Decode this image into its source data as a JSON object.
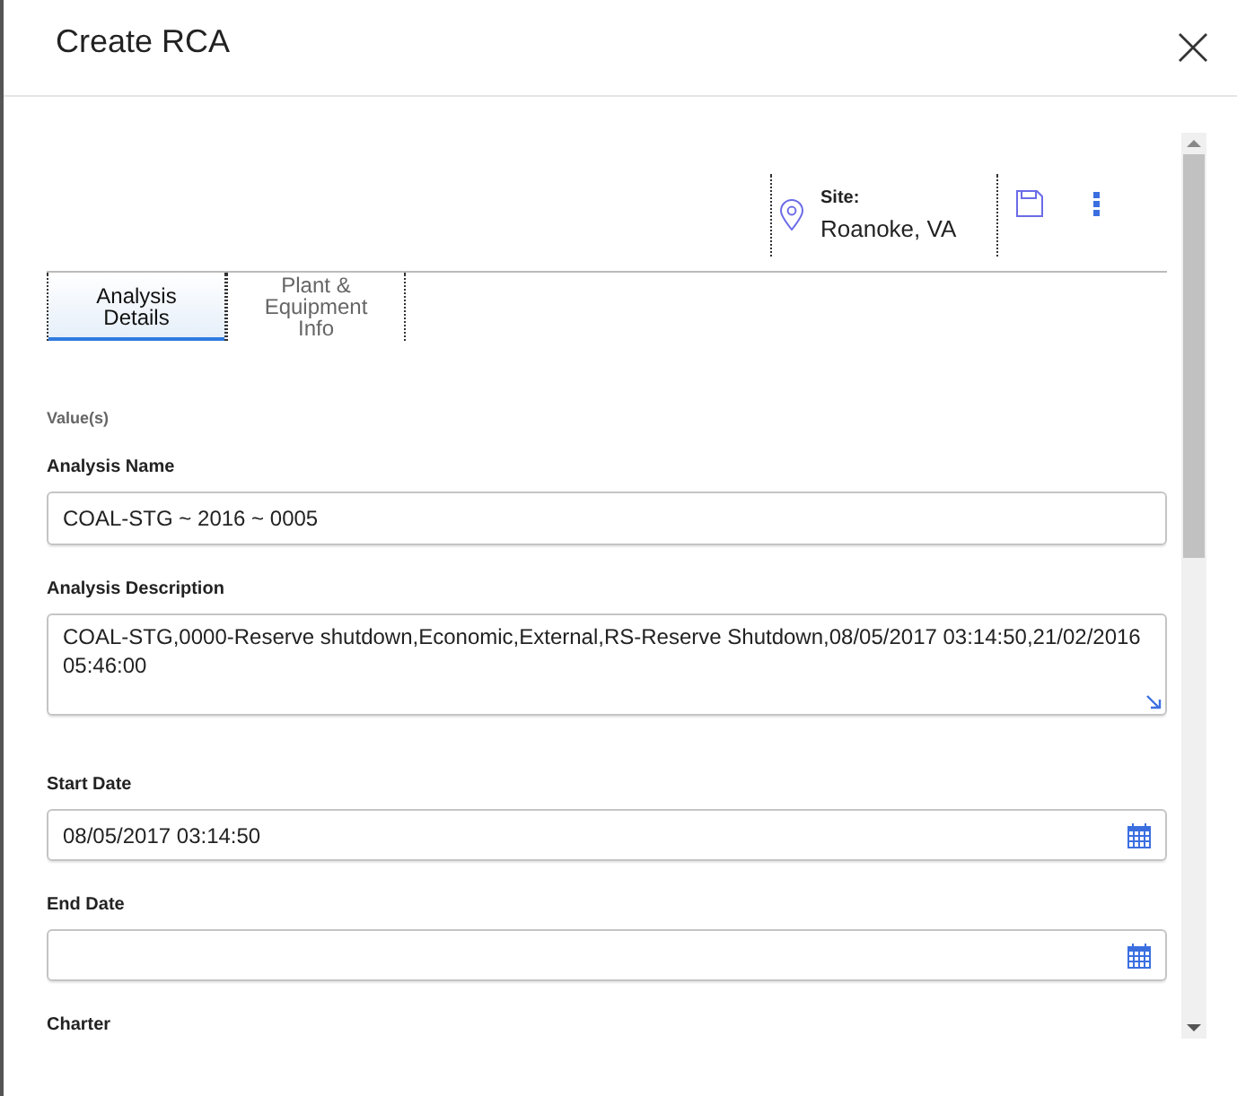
{
  "dialog": {
    "title": "Create RCA"
  },
  "site": {
    "label": "Site:",
    "value": "Roanoke, VA"
  },
  "tabs": [
    {
      "label": "Analysis Details",
      "selected": true
    },
    {
      "label": "Plant & Equipment Info",
      "selected": false
    }
  ],
  "section_label": "Value(s)",
  "fields": [
    {
      "kind": "text",
      "label": "Analysis Name",
      "value": "COAL-STG ~ 2016 ~ 0005"
    },
    {
      "kind": "textarea",
      "label": "Analysis Description",
      "value": "COAL-STG,0000-Reserve shutdown,Economic,External,RS-Reserve Shutdown,08/05/2017 03:14:50,21/02/2016 05:46:00"
    },
    {
      "kind": "date",
      "label": "Start Date",
      "value": "08/05/2017 03:14:50"
    },
    {
      "kind": "date",
      "label": "End Date"
    },
    {
      "kind": "heading",
      "label": "Charter"
    }
  ]
}
